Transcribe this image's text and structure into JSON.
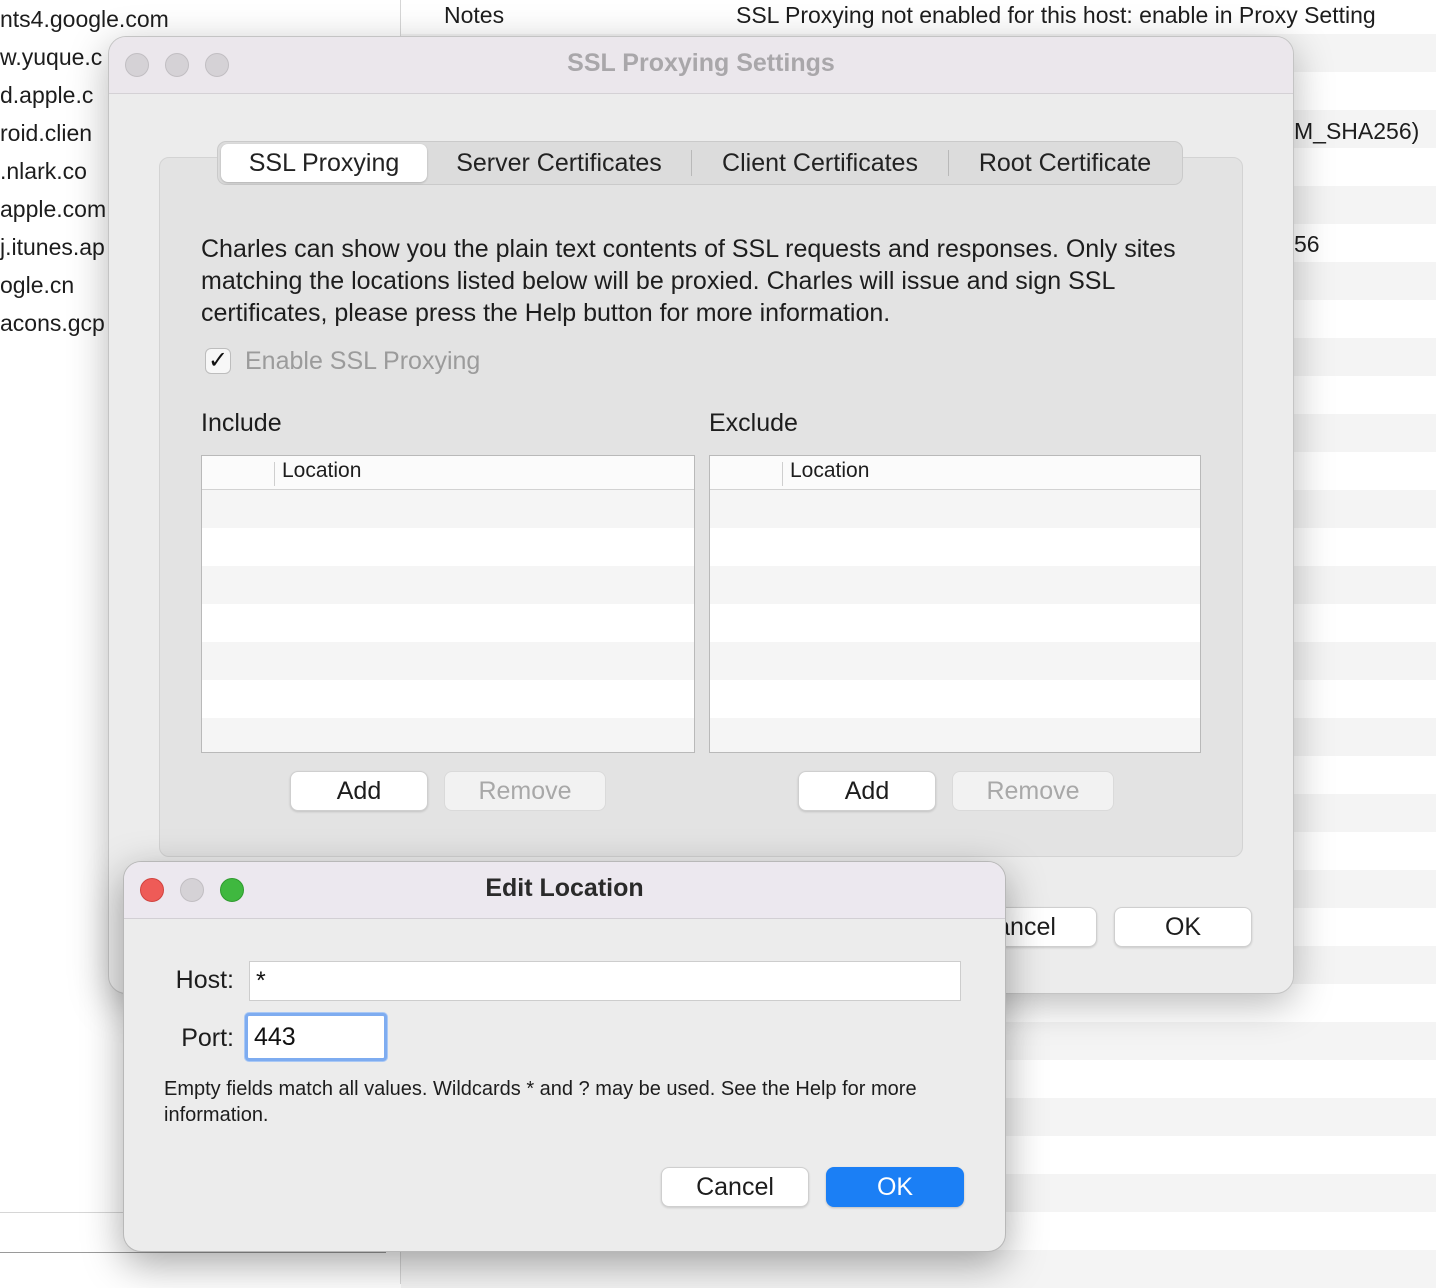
{
  "background": {
    "sidebar_hosts": [
      "nts4.google.com",
      "w.yuque.c",
      "d.apple.c",
      "roid.clien",
      ".nlark.co",
      "apple.com",
      "j.itunes.ap",
      "ogle.cn",
      "acons.gcp"
    ],
    "notes_label": "Notes",
    "notes_value": "SSL Proxying not enabled for this host: enable in Proxy Setting",
    "cipher_fragment": "M_SHA256)",
    "fragment_56": "56"
  },
  "ssl_window": {
    "title": "SSL Proxying Settings",
    "tabs": [
      {
        "label": "SSL Proxying",
        "active": true
      },
      {
        "label": "Server Certificates",
        "active": false
      },
      {
        "label": "Client Certificates",
        "active": false
      },
      {
        "label": "Root Certificate",
        "active": false
      }
    ],
    "description": "Charles can show you the plain text contents of SSL requests and responses. Only sites matching the locations listed below will be proxied. Charles will issue and sign SSL certificates, please press the Help button for more information.",
    "enable_label": "Enable SSL Proxying",
    "enable_checked": true,
    "include": {
      "title": "Include",
      "column": "Location",
      "rows": [],
      "add_label": "Add",
      "remove_label": "Remove"
    },
    "exclude": {
      "title": "Exclude",
      "column": "Location",
      "rows": [],
      "add_label": "Add",
      "remove_label": "Remove"
    },
    "cancel_label": "Cancel",
    "ok_label": "OK"
  },
  "edit_dialog": {
    "title": "Edit Location",
    "host_label": "Host:",
    "host_value": "*",
    "port_label": "Port:",
    "port_value": "443",
    "hint": "Empty fields match all values. Wildcards * and ? may be used. See the Help for more information.",
    "cancel_label": "Cancel",
    "ok_label": "OK"
  },
  "colors": {
    "accent": "#1b7ff5",
    "close": "#ee5b57",
    "minimize": "#d5d2d6",
    "zoom": "#3fb83f"
  }
}
